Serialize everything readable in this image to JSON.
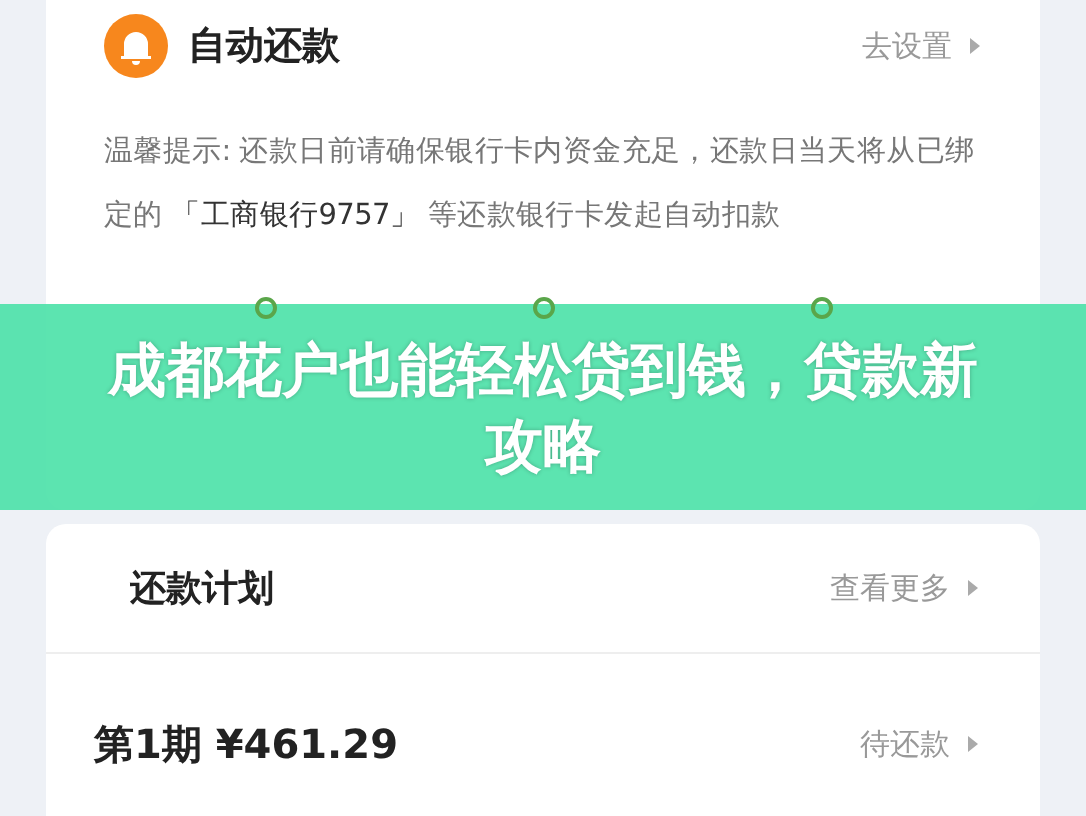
{
  "auto_repay": {
    "title": "自动还款",
    "action": "去设置",
    "tip": "温馨提示: 还款日前请确保银行卡内资金充足，还款日当天将从已绑定的 **「工商银行9757」** 等还款银行卡发起自动扣款",
    "steps": [
      {
        "kind": "ring"
      },
      {
        "kind": "ring"
      },
      {
        "kind": "ring"
      }
    ]
  },
  "banner": {
    "title": "成都花户也能轻松贷到钱，贷款新攻略"
  },
  "plan": {
    "title": "还款计划",
    "action": "查看更多",
    "rows": [
      {
        "period": "第1期",
        "amount": "¥461.29",
        "status": "待还款"
      }
    ]
  }
}
